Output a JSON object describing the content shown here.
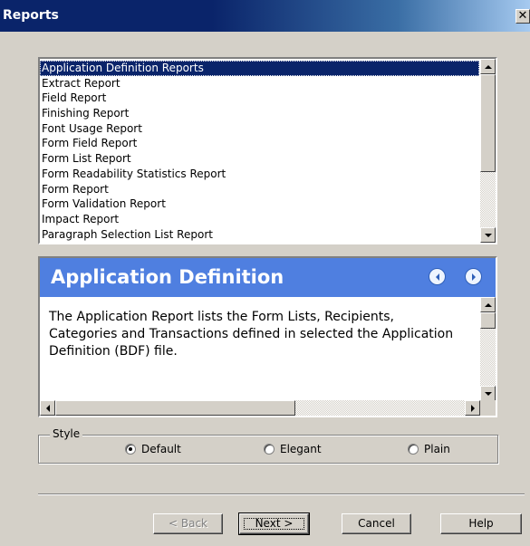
{
  "window": {
    "title": "Reports",
    "close_glyph": "✕"
  },
  "report_list": {
    "items": [
      "Application Definition Reports",
      "Extract Report",
      "Field Report",
      "Finishing Report",
      "Font Usage Report",
      "Form Field Report",
      "Form List Report",
      "Form Readability Statistics Report",
      "Form Report",
      "Form Validation Report",
      "Impact Report",
      "Paragraph Selection List Report"
    ],
    "selected_index": 0
  },
  "description": {
    "title": "Application Definition",
    "body": "The Application Report lists the Form Lists, Recipients, Categories and Transactions defined in selected the Application Definition (BDF) file.",
    "header_color": "#4f7fe0"
  },
  "style_group": {
    "label": "Style",
    "options": [
      {
        "label": "Default",
        "checked": true
      },
      {
        "label": "Elegant",
        "checked": false
      },
      {
        "label": "Plain",
        "checked": false
      }
    ]
  },
  "buttons": {
    "back": "< Back",
    "next": "Next >",
    "cancel": "Cancel",
    "help": "Help"
  },
  "colors": {
    "title_bar": "#0a246a",
    "selection": "#0a246a",
    "face": "#d4d0c8"
  }
}
